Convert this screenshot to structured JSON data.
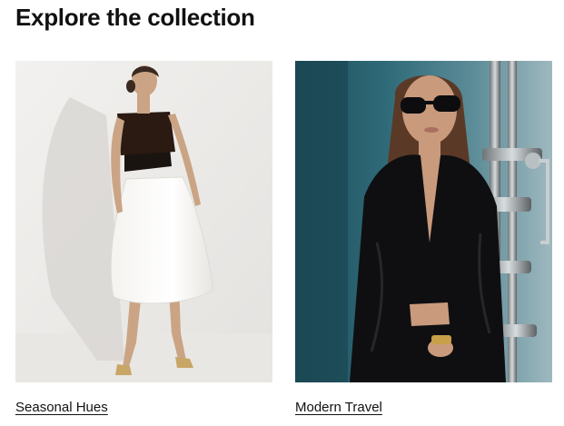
{
  "section": {
    "title": "Explore the collection"
  },
  "cards": [
    {
      "label": "Seasonal Hues",
      "image": "model-white-skirt-photo"
    },
    {
      "label": "Modern Travel",
      "image": "model-black-shirt-photo"
    }
  ],
  "colors": {
    "text": "#111111",
    "background": "#ffffff"
  }
}
